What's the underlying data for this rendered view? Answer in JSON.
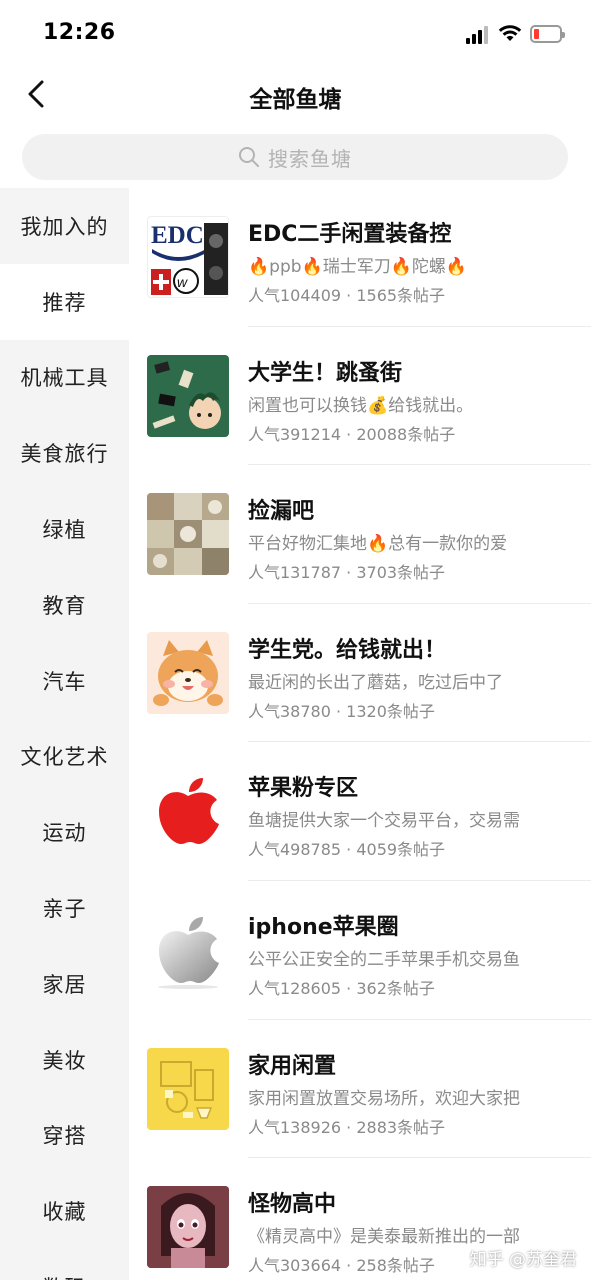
{
  "status_bar": {
    "time": "12:26",
    "battery_color": "#ff3b30"
  },
  "nav": {
    "title": "全部鱼塘",
    "back_icon": "chevron-left-icon"
  },
  "search": {
    "placeholder": "搜索鱼塘",
    "icon": "search-icon"
  },
  "sidebar": {
    "items": [
      {
        "label": "我加入的",
        "active": false
      },
      {
        "label": "推荐",
        "active": true
      },
      {
        "label": "机械工具",
        "active": false
      },
      {
        "label": "美食旅行",
        "active": false
      },
      {
        "label": "绿植",
        "active": false
      },
      {
        "label": "教育",
        "active": false
      },
      {
        "label": "汽车",
        "active": false
      },
      {
        "label": "文化艺术",
        "active": false
      },
      {
        "label": "运动",
        "active": false
      },
      {
        "label": "亲子",
        "active": false
      },
      {
        "label": "家居",
        "active": false
      },
      {
        "label": "美妆",
        "active": false
      },
      {
        "label": "穿搭",
        "active": false
      },
      {
        "label": "收藏",
        "active": false
      },
      {
        "label": "数码",
        "active": false
      }
    ]
  },
  "ponds": [
    {
      "title": "EDC二手闲置装备控",
      "desc": "🔥ppb🔥瑞士军刀🔥陀螺🔥",
      "stats": "人气104409 · 1565条帖子",
      "thumb": "edc-logo",
      "thumb_bg": "#ffffff"
    },
    {
      "title": "大学生！跳蚤街",
      "desc": "闲置也可以换钱💰给钱就出。",
      "stats": "人气391214 · 20088条帖子",
      "thumb": "green-anime",
      "thumb_bg": "#2e6b4a"
    },
    {
      "title": "捡漏吧",
      "desc": "平台好物汇集地🔥总有一款你的爱",
      "stats": "人气131787 · 3703条帖子",
      "thumb": "photo-grid",
      "thumb_bg": "#c8bfa8"
    },
    {
      "title": "学生党。给钱就出！",
      "desc": "最近闲的长出了蘑菇，吃过后中了",
      "stats": "人气38780 · 1320条帖子",
      "thumb": "shiba-dog",
      "thumb_bg": "#fde9dc"
    },
    {
      "title": "苹果粉专区",
      "desc": "鱼塘提供大家一个交易平台，交易需",
      "stats": "人气498785 · 4059条帖子",
      "thumb": "red-apple-logo",
      "thumb_bg": "#ffffff"
    },
    {
      "title": "iphone苹果圈",
      "desc": "公平公正安全的二手苹果手机交易鱼",
      "stats": "人气128605 · 362条帖子",
      "thumb": "silver-apple-logo",
      "thumb_bg": "#ffffff"
    },
    {
      "title": "家用闲置",
      "desc": "家用闲置放置交易场所，欢迎大家把",
      "stats": "人气138926 · 2883条帖子",
      "thumb": "yellow-home",
      "thumb_bg": "#f7d84a"
    },
    {
      "title": "怪物高中",
      "desc": "《精灵高中》是美泰最新推出的一部",
      "stats": "人气303664 · 258条帖子",
      "thumb": "doll-photo",
      "thumb_bg": "#8a4a4f"
    }
  ],
  "watermark": "知乎 @苏奎君"
}
